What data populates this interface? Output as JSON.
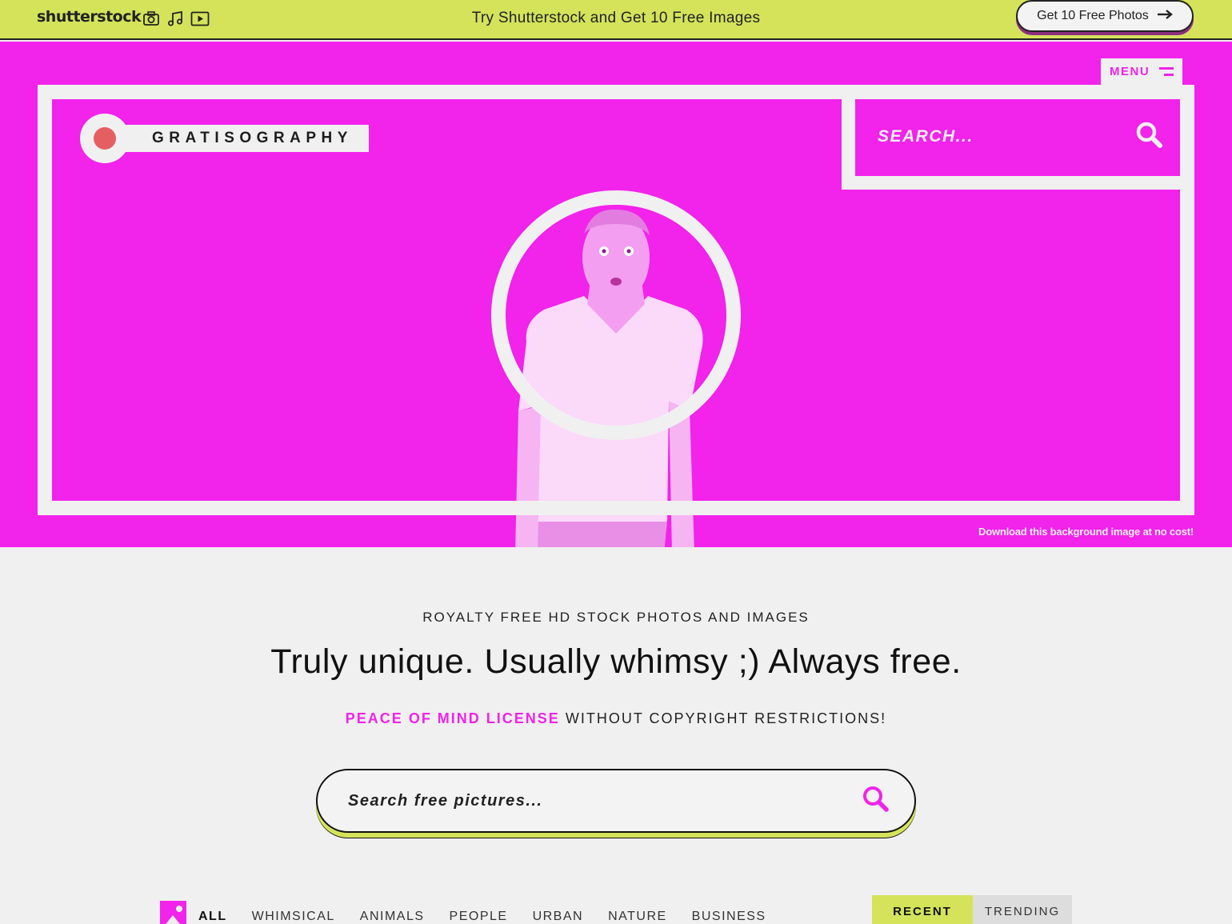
{
  "promo_bar": {
    "logo": "shutterstock",
    "icons": [
      "camera-icon",
      "music-icon",
      "video-icon"
    ],
    "text": "Try Shutterstock and Get 10 Free Images",
    "button_label": "Get 10 Free Photos",
    "button_icon": "arrow-right-icon",
    "background_color": "#d4e35a"
  },
  "hero": {
    "background_color": "#f223ea",
    "menu_label": "MENU",
    "site_name": "GRATISOGRAPHY",
    "search_placeholder": "SEARCH...",
    "download_note": "Download this background image at no cost!"
  },
  "intro": {
    "eyebrow": "ROYALTY FREE HD STOCK PHOTOS AND IMAGES",
    "headline": "Truly unique. Usually whimsy ;) Always free.",
    "license_highlight": "PEACE OF MIND LICENSE",
    "license_rest": " WITHOUT COPYRIGHT RESTRICTIONS!"
  },
  "main_search": {
    "placeholder": "Search free pictures..."
  },
  "categories": [
    "ALL",
    "WHIMSICAL",
    "ANIMALS",
    "PEOPLE",
    "URBAN",
    "NATURE",
    "BUSINESS"
  ],
  "sort": {
    "recent": "RECENT",
    "trending": "TRENDING"
  }
}
